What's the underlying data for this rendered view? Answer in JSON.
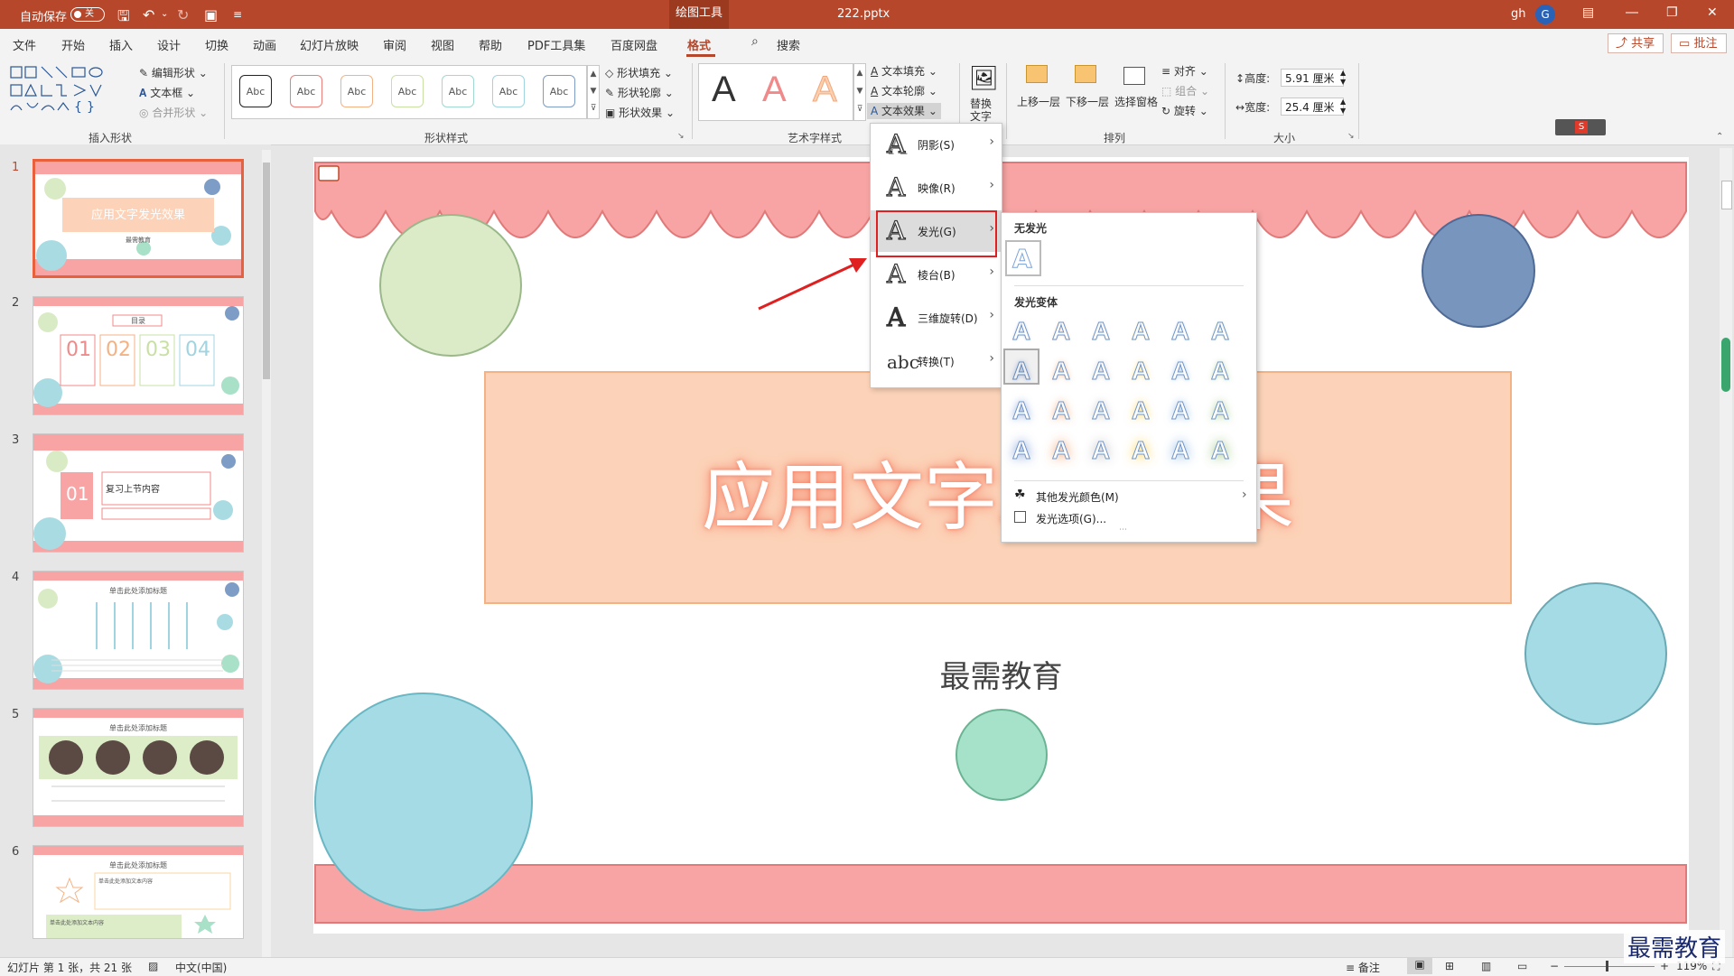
{
  "titlebar": {
    "autosave_label": "自动保存",
    "autosave_state": "关",
    "context_tab": "绘图工具",
    "filename": "222.pptx",
    "user": "gh",
    "avatar_letter": "G"
  },
  "menubar": {
    "tabs": [
      "文件",
      "开始",
      "插入",
      "设计",
      "切换",
      "动画",
      "幻灯片放映",
      "审阅",
      "视图",
      "帮助",
      "PDF工具集",
      "百度网盘",
      "格式"
    ],
    "search": "搜索",
    "share": "共享",
    "comments": "批注"
  },
  "ribbon": {
    "groups": {
      "insert_shapes": "插入形状",
      "shape_styles": "形状样式",
      "wordart_styles": "艺术字样式",
      "arrange": "排列",
      "size": "大小"
    },
    "edit_shape": "编辑形状",
    "text_box": "文本框",
    "merge_shapes": "合并形状",
    "shape_sample": "Abc",
    "shape_fill": "形状填充",
    "shape_outline": "形状轮廓",
    "shape_effects": "形状效果",
    "text_fill": "文本填充",
    "text_outline": "文本轮廓",
    "text_effects": "文本效果",
    "alt_text_line1": "替换",
    "alt_text_line2": "文字",
    "bring_forward": "上移一层",
    "send_backward": "下移一层",
    "selection_pane": "选择窗格",
    "align": "对齐",
    "group": "组合",
    "rotate": "旋转",
    "height_label": "高度:",
    "height_value": "5.91 厘米",
    "width_label": "宽度:",
    "width_value": "25.4 厘米"
  },
  "thumbnails": {
    "numbers": [
      "1",
      "2",
      "3",
      "4",
      "5",
      "6"
    ],
    "t1_title": "应用文字发光效果",
    "t1_sub": "最需教育",
    "t2_title": "目录",
    "t2_nums": [
      "01",
      "02",
      "03",
      "04"
    ],
    "t3_num": "01",
    "t3_title": "复习上节内容",
    "t4_title": "单击此处添加标题",
    "t5_title": "单击此处添加标题",
    "t6_title": "单击此处添加标题",
    "t6_text1": "单击此处添加文本内容",
    "t6_text2": "单击此处添加文本内容"
  },
  "slide": {
    "title": "应用文字发光效果",
    "subtitle": "最需教育"
  },
  "text_effects_menu": {
    "items": [
      "阴影(S)",
      "映像(R)",
      "发光(G)",
      "棱台(B)",
      "三维旋转(D)",
      "转换(T)"
    ],
    "selected": "发光(G)"
  },
  "glow_menu": {
    "no_glow": "无发光",
    "variants": "发光变体",
    "more_colors": "其他发光颜色(M)",
    "options": "发光选项(G)...",
    "glyph": "A",
    "colors": [
      "#4472c4",
      "#ed7d31",
      "#a5a5a5",
      "#ffc000",
      "#5b9bd5",
      "#70ad47"
    ]
  },
  "status": {
    "slide_info": "幻灯片 第 1 张，共 21 张",
    "language": "中文(中国)",
    "notes": "备注",
    "zoom": "119%"
  },
  "watermark": "最需教育"
}
